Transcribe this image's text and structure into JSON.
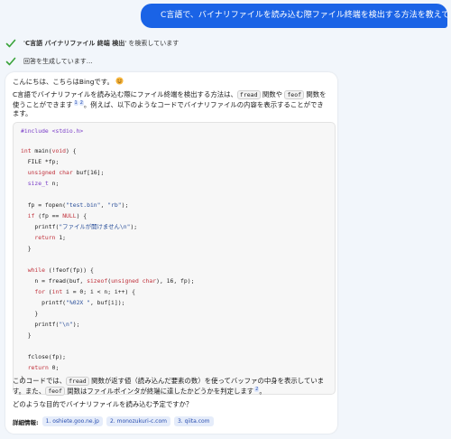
{
  "user_message": "C言語で、バイナリファイルを読み込む際ファイル終端を検出する方法を教えてくださいまし",
  "status": {
    "search_query": "C言語 バイナリファイル 終端 検出",
    "search_suffix": " を検索しています",
    "generating": "回答を生成しています…"
  },
  "answer": {
    "greeting": "こんにちは、こちらはBingです。",
    "intro_1": "C言語でバイナリファイルを読み込む際にファイル終端を検出する方法は、",
    "chip_fread": "fread",
    "intro_2": " 関数や ",
    "chip_feof": "feof",
    "intro_3": " 関数を使うことができます",
    "ref1": "1",
    "ref2": "2",
    "intro_4": "。例えば、以下のようなコードでバイナリファイルの内容を表示することができます。",
    "code": [
      "#include <stdio.h>",
      "",
      "int main(void) {",
      "  FILE *fp;",
      "  unsigned char buf[16];",
      "  size_t n;",
      "",
      "  fp = fopen(\"test.bin\", \"rb\");",
      "  if (fp == NULL) {",
      "    printf(\"ファイルが開けません\\n\");",
      "    return 1;",
      "  }",
      "",
      "  while (!feof(fp)) {",
      "    n = fread(buf, sizeof(unsigned char), 16, fp);",
      "    for (int i = 0; i < n; i++) {",
      "      printf(\"%02X \", buf[i]);",
      "    }",
      "    printf(\"\\n\");",
      "  }",
      "",
      "  fclose(fp);",
      "  return 0;",
      "}"
    ],
    "outro_1": "このコードでは、",
    "outro_chip_fread": "fread",
    "outro_2": " 関数が返す値（読み込んだ要素の数）を使ってバッファの中身を表示しています。また、",
    "outro_chip_feof": "feof",
    "outro_3": " 関数はファイルポインタが終端に達したかどうかを判定します",
    "outro_ref": "2",
    "outro_4": "。",
    "question": "どのような目的でバイナリファイルを読み込む予定ですか？",
    "refs_label": "詳細情報:",
    "refs": [
      "1. oshiete.goo.ne.jp",
      "2. monozukuri-c.com",
      "3. qiita.com"
    ]
  },
  "colors": {
    "user_bubble": "#1a63e6",
    "check": "#3aa33a",
    "ref_chip_bg": "#e5ecfa"
  }
}
